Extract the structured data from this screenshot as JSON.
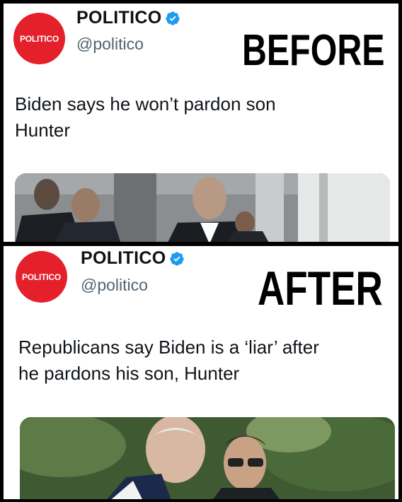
{
  "before": {
    "avatar_text": "POLITICO",
    "display_name": "POLITICO",
    "handle": "@politico",
    "stamp": "BEFORE",
    "tweet_line_1": "Biden says he won’t pardon son",
    "tweet_line_2": "Hunter"
  },
  "after": {
    "avatar_text": "POLITICO",
    "display_name": "POLITICO",
    "handle": "@politico",
    "stamp": "AFTER",
    "tweet_line_1": "Republicans say Biden is a ‘liar’ after",
    "tweet_line_2": "he pardons his son, Hunter"
  },
  "colors": {
    "brand_red": "#e4202a",
    "verified_blue": "#1d9bf0",
    "handle_gray": "#536471"
  },
  "icons": [
    "verified-badge-icon"
  ]
}
